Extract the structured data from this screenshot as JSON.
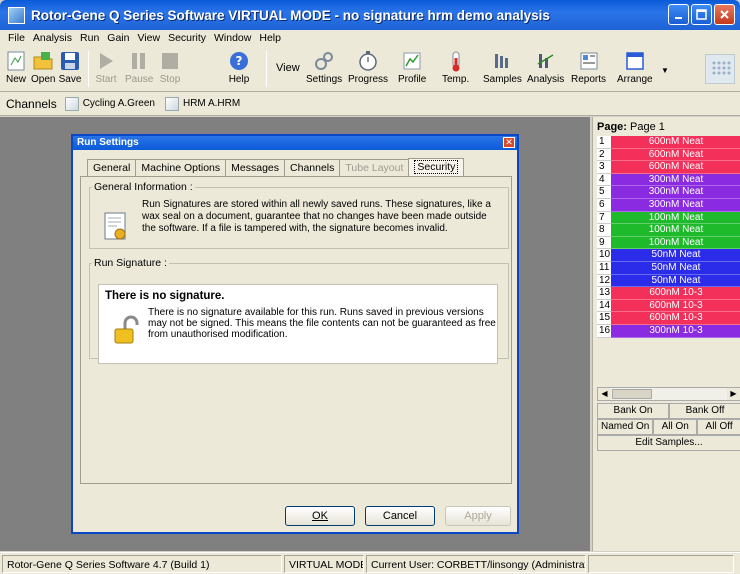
{
  "window": {
    "title": "Rotor-Gene Q Series Software VIRTUAL MODE - no signature hrm demo analysis"
  },
  "menu": [
    "File",
    "Analysis",
    "Run",
    "Gain",
    "View",
    "Security",
    "Window",
    "Help"
  ],
  "toolbar": {
    "new": "New",
    "open": "Open",
    "save": "Save",
    "start": "Start",
    "pause": "Pause",
    "stop": "Stop",
    "help": "Help",
    "view": "View",
    "settings": "Settings",
    "progress": "Progress",
    "profile": "Profile",
    "temp": "Temp.",
    "samples": "Samples",
    "analysis": "Analysis",
    "reports": "Reports",
    "arrange": "Arrange"
  },
  "channels": {
    "title": "Channels",
    "items": [
      "Cycling A.Green",
      "HRM A.HRM"
    ]
  },
  "dialog": {
    "title": "Run Settings",
    "tabs": [
      "General",
      "Machine Options",
      "Messages",
      "Channels",
      "Tube Layout",
      "Security"
    ],
    "general_info": {
      "legend": "General Information :",
      "text": "Run Signatures are stored within all newly saved runs. These signatures, like a wax seal on a document, guarantee that no changes have been made outside the software. If a file is tampered with, the signature becomes invalid."
    },
    "run_signature": {
      "legend": "Run Signature :",
      "heading": "There is no signature.",
      "text": "There is no signature available for this run. Runs saved in previous versions may not be signed. This means the file contents can not be guaranteed as free from unauthorised modification."
    },
    "buttons": {
      "ok": "OK",
      "cancel": "Cancel",
      "apply": "Apply"
    }
  },
  "samples": {
    "page_label": "Page:",
    "page_value": "Page 1",
    "rows": [
      {
        "num": "1",
        "name": "600nM Neat",
        "color": "#f2305a"
      },
      {
        "num": "2",
        "name": "600nM Neat",
        "color": "#f2305a"
      },
      {
        "num": "3",
        "name": "600nM Neat",
        "color": "#f2305a"
      },
      {
        "num": "4",
        "name": "300nM Neat",
        "color": "#8a2be2"
      },
      {
        "num": "5",
        "name": "300nM Neat",
        "color": "#8a2be2"
      },
      {
        "num": "6",
        "name": "300nM Neat",
        "color": "#8a2be2"
      },
      {
        "num": "7",
        "name": "100nM Neat",
        "color": "#1fba2c"
      },
      {
        "num": "8",
        "name": "100nM Neat",
        "color": "#1fba2c"
      },
      {
        "num": "9",
        "name": "100nM Neat",
        "color": "#1fba2c"
      },
      {
        "num": "10",
        "name": "50nM Neat",
        "color": "#2b2bea"
      },
      {
        "num": "11",
        "name": "50nM Neat",
        "color": "#2b2bea"
      },
      {
        "num": "12",
        "name": "50nM Neat",
        "color": "#2b2bea"
      },
      {
        "num": "13",
        "name": "600nM 10-3",
        "color": "#f2305a"
      },
      {
        "num": "14",
        "name": "600nM 10-3",
        "color": "#f2305a"
      },
      {
        "num": "15",
        "name": "600nM 10-3",
        "color": "#f2305a"
      },
      {
        "num": "16",
        "name": "300nM 10-3",
        "color": "#8a2be2"
      }
    ],
    "bank_on": "Bank On",
    "bank_off": "Bank Off",
    "named_on": "Named On",
    "all_on": "All On",
    "all_off": "All Off",
    "edit_samples": "Edit Samples..."
  },
  "status": {
    "version": "Rotor-Gene Q Series Software 4.7 (Build 1)",
    "mode": "VIRTUAL MODE",
    "user": "Current User: CORBETT/linsongy (Administrators)"
  }
}
